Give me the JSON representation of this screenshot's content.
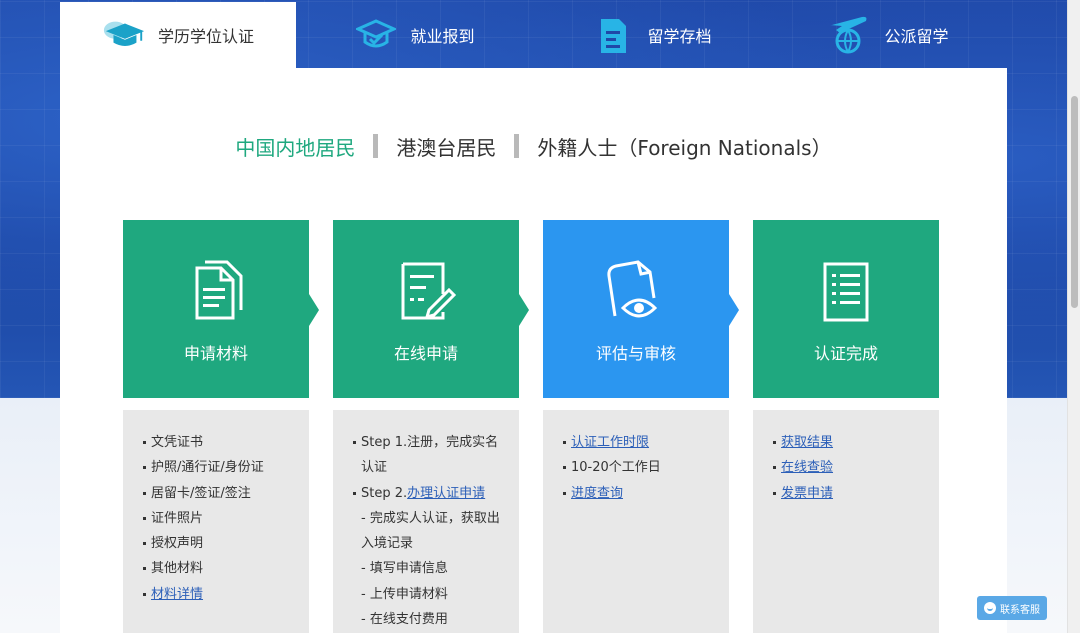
{
  "nav_tabs": [
    {
      "label": "学历学位认证",
      "icon": "graduation-cap-icon",
      "active": true
    },
    {
      "label": "就业报到",
      "icon": "graduation-cap-outline-icon",
      "active": false
    },
    {
      "label": "留学存档",
      "icon": "archive-document-icon",
      "active": false
    },
    {
      "label": "公派留学",
      "icon": "airplane-globe-icon",
      "active": false
    }
  ],
  "regions": [
    {
      "label": "中国内地居民",
      "active": true
    },
    {
      "label": "港澳台居民",
      "active": false
    },
    {
      "label": "外籍人士（Foreign Nationals）",
      "active": false
    }
  ],
  "steps": [
    {
      "label": "申请材料",
      "icon": "documents-icon",
      "color": "#1fa87f"
    },
    {
      "label": "在线申请",
      "icon": "edit-form-icon",
      "color": "#1fa87f"
    },
    {
      "label": "评估与审核",
      "icon": "document-eye-icon",
      "color": "#2b96f0"
    },
    {
      "label": "认证完成",
      "icon": "checklist-icon",
      "color": "#1fa87f"
    }
  ],
  "details": {
    "materials": {
      "items": [
        "文凭证书",
        "护照/通行证/身份证",
        "居留卡/签证/签注",
        "证件照片",
        "授权声明",
        "其他材料"
      ],
      "link": "材料详情"
    },
    "online": {
      "step1": "Step 1.注册，完成实名认证",
      "step2_prefix": "Step 2.",
      "step2_link": "办理认证申请",
      "sub": [
        "- 完成实人认证，获取出入境记录",
        "- 填写申请信息",
        "- 上传申请材料",
        "- 在线支付费用"
      ]
    },
    "review": {
      "link1": "认证工作时限",
      "text": "10-20个工作日",
      "link2": "进度查询"
    },
    "complete": {
      "links": [
        "获取结果",
        "在线查验",
        "发票申请"
      ]
    }
  },
  "chat_button": "联系客服",
  "colors": {
    "green": "#1fa87f",
    "blue": "#2b96f0",
    "nav_bg": "#1f48a8",
    "link": "#2c5fb8"
  }
}
